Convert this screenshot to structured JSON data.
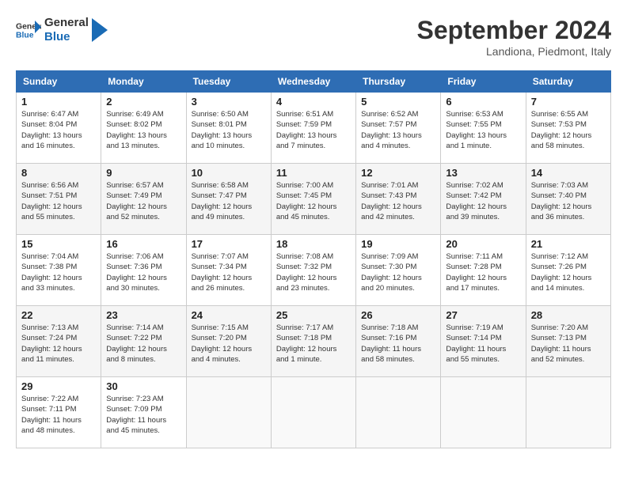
{
  "header": {
    "logo_general": "General",
    "logo_blue": "Blue",
    "month_title": "September 2024",
    "subtitle": "Landiona, Piedmont, Italy"
  },
  "weekdays": [
    "Sunday",
    "Monday",
    "Tuesday",
    "Wednesday",
    "Thursday",
    "Friday",
    "Saturday"
  ],
  "weeks": [
    [
      {
        "day": "1",
        "info": "Sunrise: 6:47 AM\nSunset: 8:04 PM\nDaylight: 13 hours\nand 16 minutes."
      },
      {
        "day": "2",
        "info": "Sunrise: 6:49 AM\nSunset: 8:02 PM\nDaylight: 13 hours\nand 13 minutes."
      },
      {
        "day": "3",
        "info": "Sunrise: 6:50 AM\nSunset: 8:01 PM\nDaylight: 13 hours\nand 10 minutes."
      },
      {
        "day": "4",
        "info": "Sunrise: 6:51 AM\nSunset: 7:59 PM\nDaylight: 13 hours\nand 7 minutes."
      },
      {
        "day": "5",
        "info": "Sunrise: 6:52 AM\nSunset: 7:57 PM\nDaylight: 13 hours\nand 4 minutes."
      },
      {
        "day": "6",
        "info": "Sunrise: 6:53 AM\nSunset: 7:55 PM\nDaylight: 13 hours\nand 1 minute."
      },
      {
        "day": "7",
        "info": "Sunrise: 6:55 AM\nSunset: 7:53 PM\nDaylight: 12 hours\nand 58 minutes."
      }
    ],
    [
      {
        "day": "8",
        "info": "Sunrise: 6:56 AM\nSunset: 7:51 PM\nDaylight: 12 hours\nand 55 minutes."
      },
      {
        "day": "9",
        "info": "Sunrise: 6:57 AM\nSunset: 7:49 PM\nDaylight: 12 hours\nand 52 minutes."
      },
      {
        "day": "10",
        "info": "Sunrise: 6:58 AM\nSunset: 7:47 PM\nDaylight: 12 hours\nand 49 minutes."
      },
      {
        "day": "11",
        "info": "Sunrise: 7:00 AM\nSunset: 7:45 PM\nDaylight: 12 hours\nand 45 minutes."
      },
      {
        "day": "12",
        "info": "Sunrise: 7:01 AM\nSunset: 7:43 PM\nDaylight: 12 hours\nand 42 minutes."
      },
      {
        "day": "13",
        "info": "Sunrise: 7:02 AM\nSunset: 7:42 PM\nDaylight: 12 hours\nand 39 minutes."
      },
      {
        "day": "14",
        "info": "Sunrise: 7:03 AM\nSunset: 7:40 PM\nDaylight: 12 hours\nand 36 minutes."
      }
    ],
    [
      {
        "day": "15",
        "info": "Sunrise: 7:04 AM\nSunset: 7:38 PM\nDaylight: 12 hours\nand 33 minutes."
      },
      {
        "day": "16",
        "info": "Sunrise: 7:06 AM\nSunset: 7:36 PM\nDaylight: 12 hours\nand 30 minutes."
      },
      {
        "day": "17",
        "info": "Sunrise: 7:07 AM\nSunset: 7:34 PM\nDaylight: 12 hours\nand 26 minutes."
      },
      {
        "day": "18",
        "info": "Sunrise: 7:08 AM\nSunset: 7:32 PM\nDaylight: 12 hours\nand 23 minutes."
      },
      {
        "day": "19",
        "info": "Sunrise: 7:09 AM\nSunset: 7:30 PM\nDaylight: 12 hours\nand 20 minutes."
      },
      {
        "day": "20",
        "info": "Sunrise: 7:11 AM\nSunset: 7:28 PM\nDaylight: 12 hours\nand 17 minutes."
      },
      {
        "day": "21",
        "info": "Sunrise: 7:12 AM\nSunset: 7:26 PM\nDaylight: 12 hours\nand 14 minutes."
      }
    ],
    [
      {
        "day": "22",
        "info": "Sunrise: 7:13 AM\nSunset: 7:24 PM\nDaylight: 12 hours\nand 11 minutes."
      },
      {
        "day": "23",
        "info": "Sunrise: 7:14 AM\nSunset: 7:22 PM\nDaylight: 12 hours\nand 8 minutes."
      },
      {
        "day": "24",
        "info": "Sunrise: 7:15 AM\nSunset: 7:20 PM\nDaylight: 12 hours\nand 4 minutes."
      },
      {
        "day": "25",
        "info": "Sunrise: 7:17 AM\nSunset: 7:18 PM\nDaylight: 12 hours\nand 1 minute."
      },
      {
        "day": "26",
        "info": "Sunrise: 7:18 AM\nSunset: 7:16 PM\nDaylight: 11 hours\nand 58 minutes."
      },
      {
        "day": "27",
        "info": "Sunrise: 7:19 AM\nSunset: 7:14 PM\nDaylight: 11 hours\nand 55 minutes."
      },
      {
        "day": "28",
        "info": "Sunrise: 7:20 AM\nSunset: 7:13 PM\nDaylight: 11 hours\nand 52 minutes."
      }
    ],
    [
      {
        "day": "29",
        "info": "Sunrise: 7:22 AM\nSunset: 7:11 PM\nDaylight: 11 hours\nand 48 minutes."
      },
      {
        "day": "30",
        "info": "Sunrise: 7:23 AM\nSunset: 7:09 PM\nDaylight: 11 hours\nand 45 minutes."
      },
      null,
      null,
      null,
      null,
      null
    ]
  ]
}
